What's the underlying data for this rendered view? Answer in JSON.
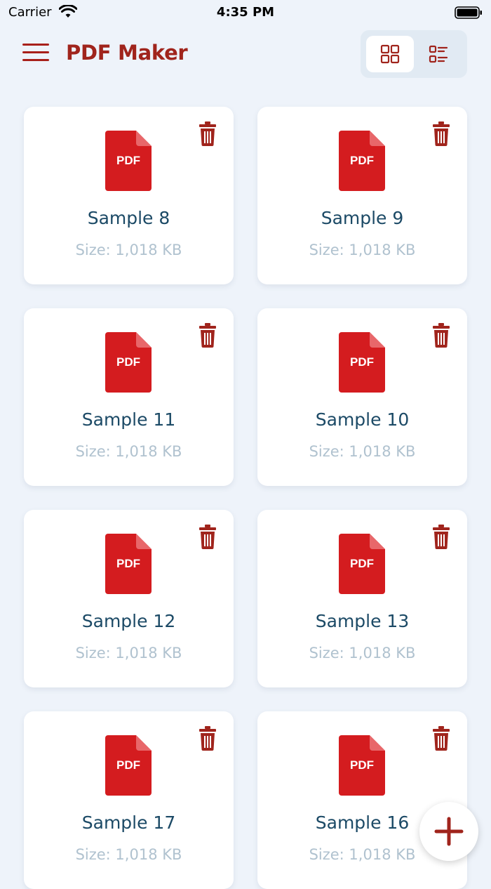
{
  "status_bar": {
    "carrier": "Carrier",
    "time": "4:35 PM"
  },
  "header": {
    "title": "PDF Maker"
  },
  "colors": {
    "accent": "#a0241c",
    "pdf_red": "#d41c1f",
    "name_text": "#1c4a66",
    "size_text": "#b0c2cf",
    "background": "#eef3fa"
  },
  "icons": {
    "menu": "hamburger-icon",
    "grid": "grid-view-icon",
    "list": "list-view-icon",
    "trash": "trash-icon",
    "add": "plus-icon",
    "file": "pdf-file-icon"
  },
  "files": [
    {
      "name": "Sample 8",
      "size": "Size: 1,018 KB",
      "badge": "PDF"
    },
    {
      "name": "Sample 9",
      "size": "Size: 1,018 KB",
      "badge": "PDF"
    },
    {
      "name": "Sample 11",
      "size": "Size: 1,018 KB",
      "badge": "PDF"
    },
    {
      "name": "Sample 10",
      "size": "Size: 1,018 KB",
      "badge": "PDF"
    },
    {
      "name": "Sample 12",
      "size": "Size: 1,018 KB",
      "badge": "PDF"
    },
    {
      "name": "Sample 13",
      "size": "Size: 1,018 KB",
      "badge": "PDF"
    },
    {
      "name": "Sample 17",
      "size": "Size: 1,018 KB",
      "badge": "PDF"
    },
    {
      "name": "Sample 16",
      "size": "Size: 1,018 KB",
      "badge": "PDF"
    }
  ]
}
